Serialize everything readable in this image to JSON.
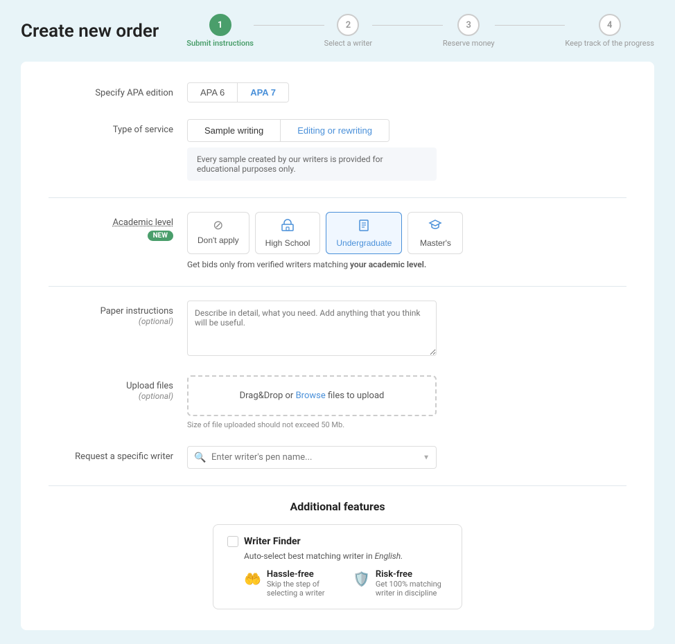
{
  "page": {
    "title": "Create new order"
  },
  "steps": [
    {
      "number": "1",
      "label": "Submit instructions",
      "active": true
    },
    {
      "number": "2",
      "label": "Select a writer",
      "active": false
    },
    {
      "number": "3",
      "label": "Reserve money",
      "active": false
    },
    {
      "number": "4",
      "label": "Keep track of the progress",
      "active": false
    }
  ],
  "form": {
    "apa_label": "Specify APA edition",
    "apa_options": [
      {
        "label": "APA 6",
        "active": false
      },
      {
        "label": "APA 7",
        "active": true
      }
    ],
    "service_label": "Type of service",
    "service_options": [
      {
        "label": "Sample writing",
        "active": true
      },
      {
        "label": "Editing or rewriting",
        "active": false
      }
    ],
    "service_note": "Every sample created by our writers is provided for educational purposes only.",
    "academic_label": "Academic level",
    "academic_new_badge": "NEW",
    "academic_levels": [
      {
        "label": "Don't apply",
        "icon": "🚫",
        "active": false,
        "type": "dont-apply"
      },
      {
        "label": "High School",
        "icon": "🏫",
        "active": false,
        "type": "normal"
      },
      {
        "label": "Undergraduate",
        "icon": "📘",
        "active": true,
        "type": "normal"
      },
      {
        "label": "Master's",
        "icon": "🎓",
        "active": false,
        "type": "normal"
      }
    ],
    "academic_note": "Get bids only from verified writers matching ",
    "academic_note_bold": "your academic level.",
    "paper_label": "Paper instructions",
    "paper_sublabel": "(optional)",
    "paper_placeholder": "Describe in detail, what you need. Add anything that you think will be useful.",
    "upload_label": "Upload files",
    "upload_sublabel": "(optional)",
    "upload_text": "Drag&Drop or ",
    "upload_browse": "Browse",
    "upload_text2": " files to upload",
    "upload_note": "Size of file uploaded should not exceed 50 Mb.",
    "writer_label": "Request a specific writer",
    "writer_placeholder": "Enter writer's pen name...",
    "additional_title": "Additional features",
    "feature_card": {
      "title": "Writer Finder",
      "subtitle_pre": "Auto-select best matching writer in ",
      "subtitle_em": "English.",
      "items": [
        {
          "icon_name": "hassle-free-icon",
          "icon_char": "🤲",
          "title": "Hassle-free",
          "desc": "Skip the step of selecting a writer"
        },
        {
          "icon_name": "risk-free-icon",
          "icon_char": "🛡️",
          "title": "Risk-free",
          "desc": "Get 100% matching writer in discipline"
        }
      ]
    }
  }
}
